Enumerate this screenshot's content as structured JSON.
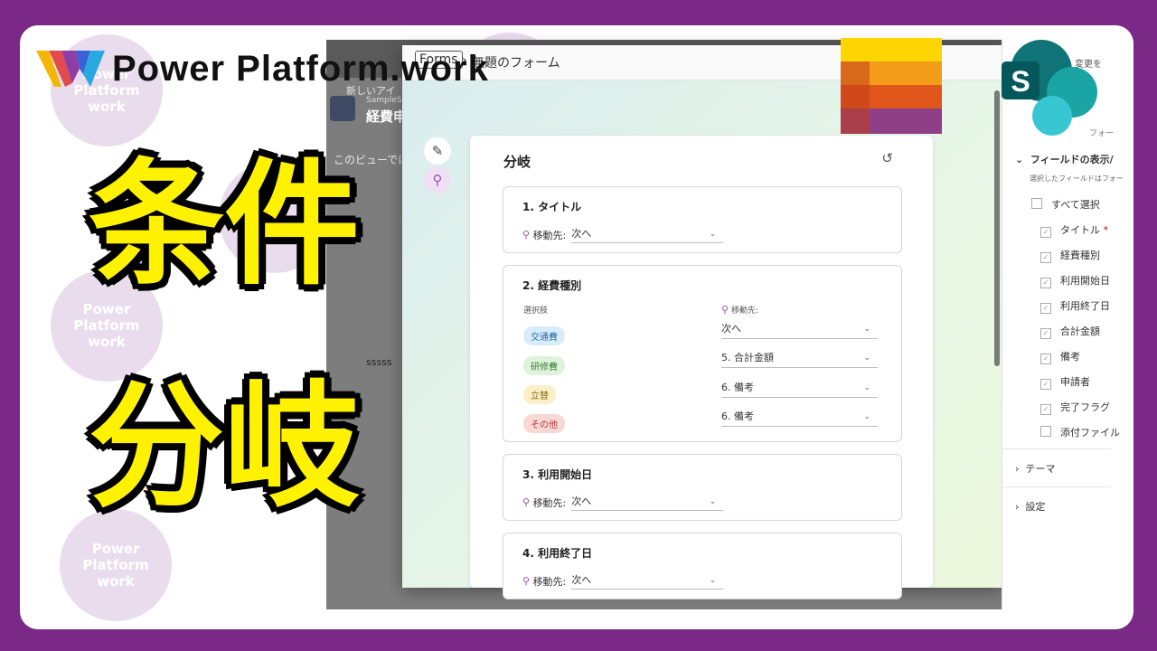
{
  "brand": {
    "name": "Power Platform.work"
  },
  "watermark": {
    "lines": [
      "Power",
      "Platform",
      "work"
    ]
  },
  "title": {
    "line1": "条件",
    "line2": "分岐"
  },
  "sharepoint_bg": {
    "breadcrumb": "新しいアイ",
    "site_small": "SampleSit",
    "list_name": "経費申",
    "view_text": "このビューでは",
    "row_text": "sssss",
    "top_right": "変更を"
  },
  "forms": {
    "brand": "Forms",
    "breadcrumb_sep": "›",
    "form_name": "無題のフォーム",
    "card_title": "分岐",
    "move_label": "移動先:",
    "move_label_plain": "移動先:",
    "choices_label": "選択肢",
    "questions": [
      {
        "title": "1. タイトル",
        "target": "次へ"
      },
      {
        "title": "2. 経費種別",
        "choices": [
          {
            "label": "交通費",
            "target": "次へ"
          },
          {
            "label": "研修費",
            "target": "5. 合計金額"
          },
          {
            "label": "立替",
            "target": "6. 備考"
          },
          {
            "label": "その他",
            "target": "6. 備考"
          }
        ]
      },
      {
        "title": "3. 利用開始日",
        "target": "次へ"
      },
      {
        "title": "4. 利用終了日",
        "target": "次へ"
      }
    ]
  },
  "settings_panel": {
    "hint": "フォー",
    "section_fields": "フィールドの表示/",
    "section_desc": "選択したフィールドはフォー",
    "select_all": "すべて選択",
    "fields": [
      {
        "label": "タイトル",
        "required": true,
        "checked": true
      },
      {
        "label": "経費種別",
        "checked": true
      },
      {
        "label": "利用開始日",
        "checked": true
      },
      {
        "label": "利用終了日",
        "checked": true
      },
      {
        "label": "合計金額",
        "checked": true
      },
      {
        "label": "備考",
        "checked": true
      },
      {
        "label": "申請者",
        "checked": true
      },
      {
        "label": "完了フラグ",
        "checked": true
      },
      {
        "label": "添付ファイル",
        "checked": false
      }
    ],
    "theme": "テーマ",
    "settings": "設定",
    "required_mark": "*"
  },
  "colors": {
    "frame": "#7a2a86",
    "title_fill": "#fff200",
    "title_stroke": "#e01010",
    "branch": "#9b4fb0",
    "chip_blue": "#d9ecfb",
    "chip_green": "#dff3dc",
    "chip_yellow": "#fbefc8",
    "chip_red": "#f8d7d7"
  },
  "icons": [
    "power-platform-logo-icon",
    "lists-logo-icon",
    "sharepoint-logo-icon",
    "pencil-icon",
    "branch-icon",
    "reset-icon",
    "chevron-down-icon",
    "chevron-right-icon"
  ]
}
